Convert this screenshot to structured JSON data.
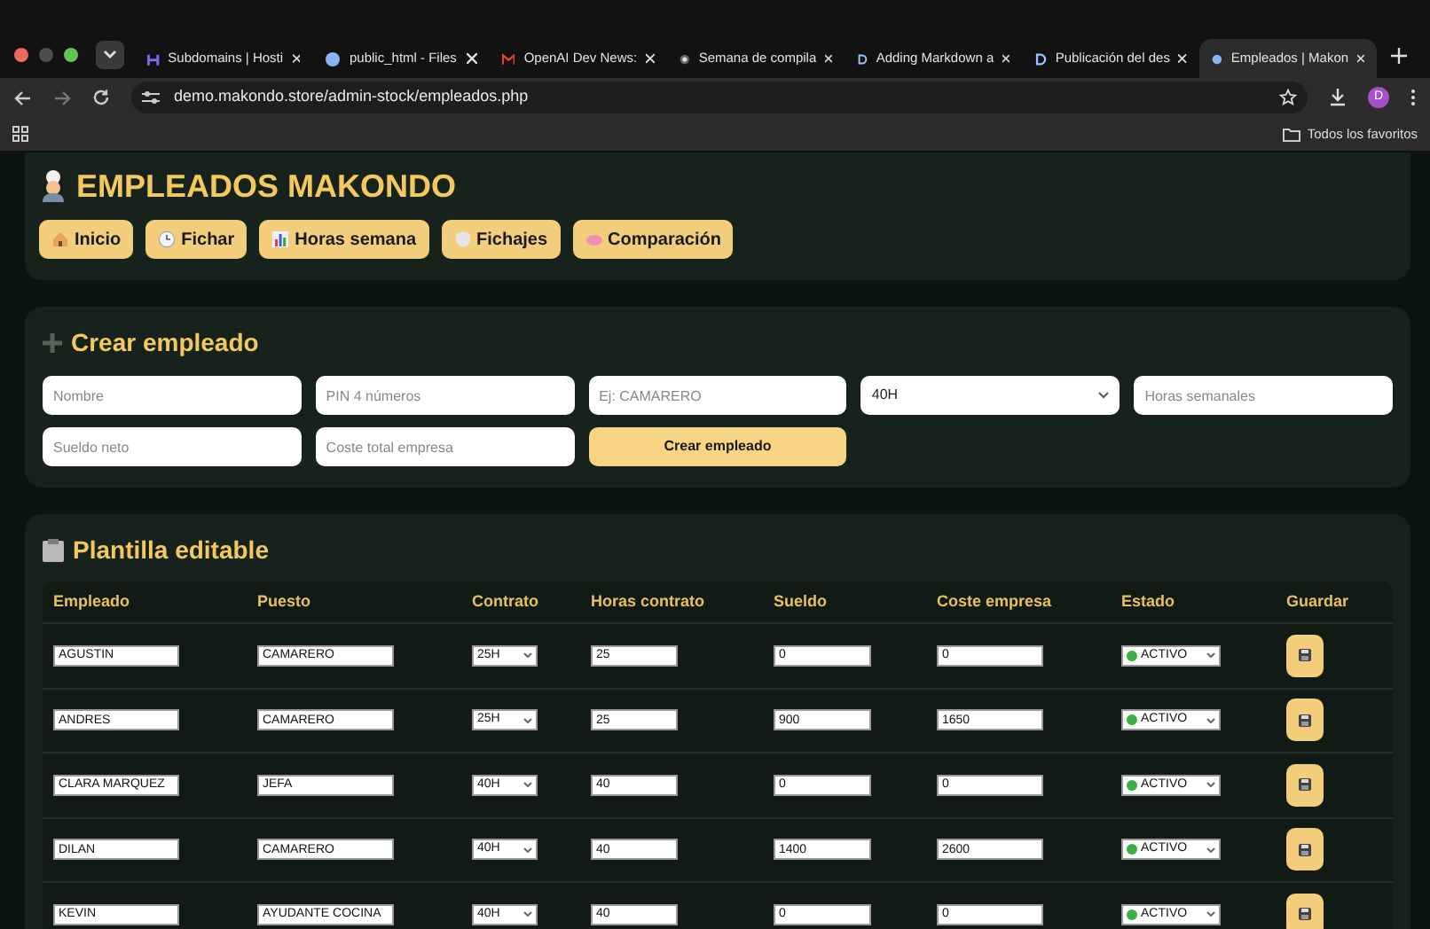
{
  "browser": {
    "tabs": [
      {
        "title": "Subdomains | Hosti",
        "selected": false
      },
      {
        "title": "public_html - Files",
        "selected": false
      },
      {
        "title": "OpenAI Dev News:",
        "selected": false
      },
      {
        "title": "Semana de compila",
        "selected": false
      },
      {
        "title": "Adding Markdown a",
        "selected": false
      },
      {
        "title": "Publicación del des",
        "selected": false
      },
      {
        "title": "Empleados | Makon",
        "selected": true
      }
    ],
    "address": "demo.makondo.store/admin-stock/empleados.php",
    "profile": "D",
    "bookmarks_folder": "Todos los favoritos"
  },
  "header": {
    "title": "EMPLEADOS MAKONDO",
    "nav": [
      {
        "label": "Inicio"
      },
      {
        "label": "Fichar"
      },
      {
        "label": "Horas semana"
      },
      {
        "label": "Fichajes"
      },
      {
        "label": "Comparación"
      }
    ]
  },
  "create": {
    "title": "Crear empleado",
    "fields": [
      {
        "kind": "input",
        "placeholder": "Nombre"
      },
      {
        "kind": "input",
        "placeholder": "PIN 4 números"
      },
      {
        "kind": "input",
        "placeholder": "Ej: CAMARERO"
      },
      {
        "kind": "select",
        "value": "40H"
      },
      {
        "kind": "input",
        "placeholder": "Horas semanales"
      },
      {
        "kind": "input",
        "placeholder": "Sueldo neto"
      },
      {
        "kind": "input",
        "placeholder": "Coste total empresa"
      },
      {
        "kind": "button",
        "label": "Crear empleado"
      }
    ]
  },
  "staff": {
    "title": "Plantilla editable",
    "columns": [
      "Empleado",
      "Puesto",
      "Contrato",
      "Horas contrato",
      "Sueldo",
      "Coste empresa",
      "Estado",
      "Guardar"
    ],
    "rows": [
      {
        "name": "AGUSTIN",
        "role": "CAMARERO",
        "contract": "25H",
        "hours": "25",
        "salary": "0",
        "cost": "0",
        "status": "ACTIVO"
      },
      {
        "name": "ANDRES",
        "role": "CAMARERO",
        "contract": "25H",
        "hours": "25",
        "salary": "900",
        "cost": "1650",
        "status": "ACTIVO"
      },
      {
        "name": "CLARA MARQUEZ",
        "role": "JEFA",
        "contract": "40H",
        "hours": "40",
        "salary": "0",
        "cost": "0",
        "status": "ACTIVO"
      },
      {
        "name": "DILAN",
        "role": "CAMARERO",
        "contract": "40H",
        "hours": "40",
        "salary": "1400",
        "cost": "2600",
        "status": "ACTIVO"
      },
      {
        "name": "KEVIN",
        "role": "AYUDANTE COCINA",
        "contract": "40H",
        "hours": "40",
        "salary": "0",
        "cost": "0",
        "status": "ACTIVO"
      }
    ]
  }
}
